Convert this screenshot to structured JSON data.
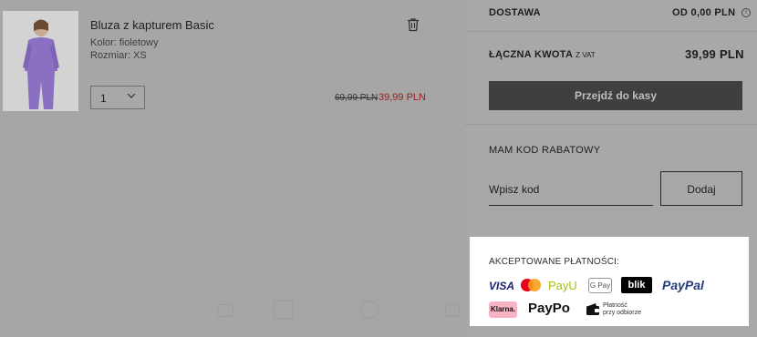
{
  "product": {
    "name": "Bluza z kapturem Basic",
    "color_label": "Kolor: fioletowy",
    "size_label": "Rozmiar: XS",
    "quantity": "1",
    "old_price": "69,99 PLN",
    "new_price": "39,99 PLN"
  },
  "summary": {
    "shipping_label": "DOSTAWA",
    "shipping_value": "OD 0,00 PLN",
    "total_label": "ŁĄCZNA KWOTA",
    "total_sub": "Z VAT",
    "total_value": "39,99 PLN",
    "checkout_label": "Przejdź do kasy",
    "discount_title": "MAM KOD RABATOWY",
    "discount_placeholder": "Wpisz kod",
    "add_label": "Dodaj"
  },
  "payments": {
    "title": "AKCEPTOWANE PŁATNOŚCI:",
    "methods": {
      "visa": "VISA",
      "payu": "PayU",
      "gpay": "G Pay",
      "blik": "blik",
      "paypal": "PayPal",
      "klarna": "Klarna.",
      "paypo": "PayPo",
      "cod_line1": "Płatność",
      "cod_line2": "przy odbiorze"
    }
  },
  "colors": {
    "overlay": "#a6a6a6",
    "price_red": "#9b1c1c",
    "checkout_bg": "#3f3f3f"
  }
}
